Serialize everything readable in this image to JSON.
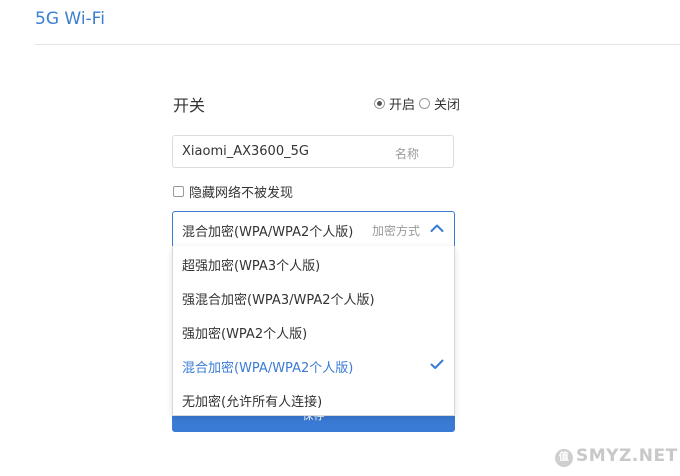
{
  "header": {
    "title": "5G Wi-Fi"
  },
  "switch": {
    "label": "开关",
    "on_label": "开启",
    "off_label": "关闭",
    "selected": "on"
  },
  "ssid": {
    "value": "Xiaomi_AX3600_5G",
    "placeholder": "名称"
  },
  "hide_network": {
    "label": "隐藏网络不被发现",
    "checked": false
  },
  "encryption": {
    "value": "混合加密(WPA/WPA2个人版)",
    "placeholder": "加密方式",
    "options": [
      "超强加密(WPA3个人版)",
      "强混合加密(WPA3/WPA2个人版)",
      "强加密(WPA2个人版)",
      "混合加密(WPA/WPA2个人版)",
      "无加密(允许所有人连接)"
    ],
    "selected_index": 3
  },
  "save_label": "保存",
  "colors": {
    "accent": "#3a7bd5",
    "title": "#3b7fcf"
  },
  "watermark": {
    "badge": "值",
    "text": "SMYZ.NET"
  }
}
